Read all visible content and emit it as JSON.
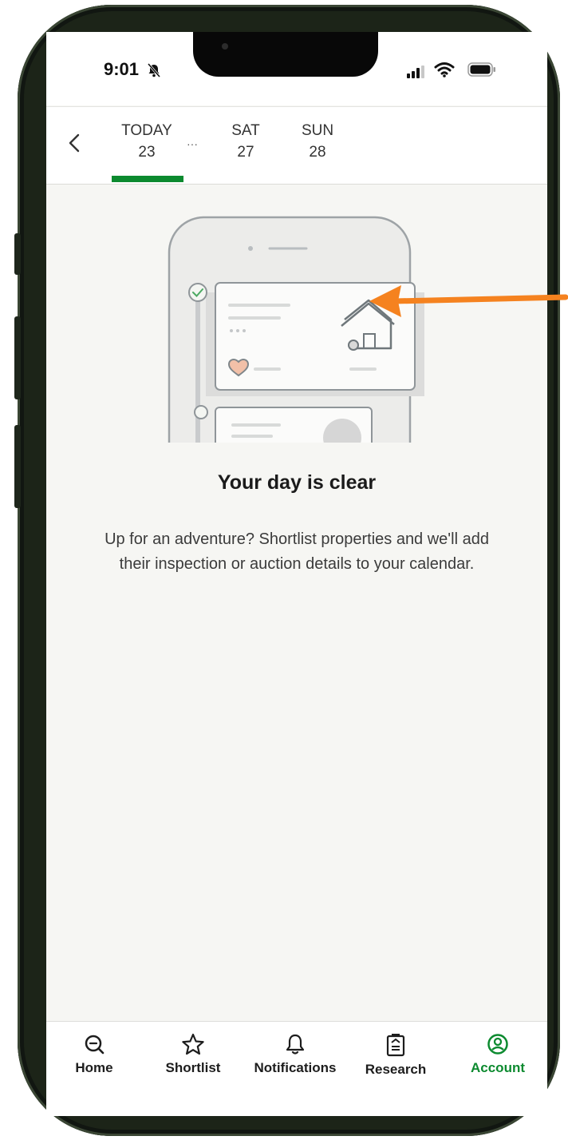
{
  "status_bar": {
    "time": "9:01"
  },
  "date_tabs": {
    "back_icon": "chevron-left-icon",
    "days": [
      {
        "label": "TODAY",
        "date": "23"
      },
      {
        "label": "SAT",
        "date": "27"
      },
      {
        "label": "SUN",
        "date": "28"
      }
    ],
    "ellipsis": "···",
    "active_color": "#0c8a2f"
  },
  "empty_state": {
    "title": "Your day is clear",
    "description": "Up for an adventure? Shortlist properties and we'll add their inspection or auction details to your calendar."
  },
  "bottom_nav": {
    "items": [
      {
        "label": "Home",
        "icon": "search-icon"
      },
      {
        "label": "Shortlist",
        "icon": "star-icon"
      },
      {
        "label": "Notifications",
        "icon": "bell-icon"
      },
      {
        "label": "Research",
        "icon": "clipboard-icon"
      },
      {
        "label": "Account",
        "icon": "user-circle-icon"
      }
    ],
    "active": "Account"
  },
  "colors": {
    "accent": "#0c8a2f",
    "annotation_arrow": "#f5821f"
  }
}
